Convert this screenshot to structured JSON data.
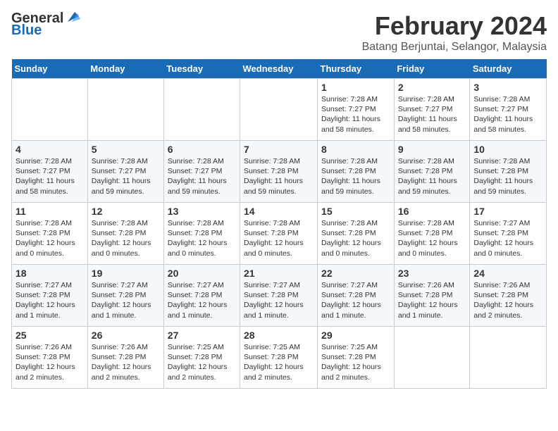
{
  "logo": {
    "line1": "General",
    "line2": "Blue"
  },
  "title": "February 2024",
  "subtitle": "Batang Berjuntai, Selangor, Malaysia",
  "weekdays": [
    "Sunday",
    "Monday",
    "Tuesday",
    "Wednesday",
    "Thursday",
    "Friday",
    "Saturday"
  ],
  "weeks": [
    [
      {
        "day": "",
        "info": ""
      },
      {
        "day": "",
        "info": ""
      },
      {
        "day": "",
        "info": ""
      },
      {
        "day": "",
        "info": ""
      },
      {
        "day": "1",
        "info": "Sunrise: 7:28 AM\nSunset: 7:27 PM\nDaylight: 11 hours\nand 58 minutes."
      },
      {
        "day": "2",
        "info": "Sunrise: 7:28 AM\nSunset: 7:27 PM\nDaylight: 11 hours\nand 58 minutes."
      },
      {
        "day": "3",
        "info": "Sunrise: 7:28 AM\nSunset: 7:27 PM\nDaylight: 11 hours\nand 58 minutes."
      }
    ],
    [
      {
        "day": "4",
        "info": "Sunrise: 7:28 AM\nSunset: 7:27 PM\nDaylight: 11 hours\nand 58 minutes."
      },
      {
        "day": "5",
        "info": "Sunrise: 7:28 AM\nSunset: 7:27 PM\nDaylight: 11 hours\nand 59 minutes."
      },
      {
        "day": "6",
        "info": "Sunrise: 7:28 AM\nSunset: 7:27 PM\nDaylight: 11 hours\nand 59 minutes."
      },
      {
        "day": "7",
        "info": "Sunrise: 7:28 AM\nSunset: 7:28 PM\nDaylight: 11 hours\nand 59 minutes."
      },
      {
        "day": "8",
        "info": "Sunrise: 7:28 AM\nSunset: 7:28 PM\nDaylight: 11 hours\nand 59 minutes."
      },
      {
        "day": "9",
        "info": "Sunrise: 7:28 AM\nSunset: 7:28 PM\nDaylight: 11 hours\nand 59 minutes."
      },
      {
        "day": "10",
        "info": "Sunrise: 7:28 AM\nSunset: 7:28 PM\nDaylight: 11 hours\nand 59 minutes."
      }
    ],
    [
      {
        "day": "11",
        "info": "Sunrise: 7:28 AM\nSunset: 7:28 PM\nDaylight: 12 hours\nand 0 minutes."
      },
      {
        "day": "12",
        "info": "Sunrise: 7:28 AM\nSunset: 7:28 PM\nDaylight: 12 hours\nand 0 minutes."
      },
      {
        "day": "13",
        "info": "Sunrise: 7:28 AM\nSunset: 7:28 PM\nDaylight: 12 hours\nand 0 minutes."
      },
      {
        "day": "14",
        "info": "Sunrise: 7:28 AM\nSunset: 7:28 PM\nDaylight: 12 hours\nand 0 minutes."
      },
      {
        "day": "15",
        "info": "Sunrise: 7:28 AM\nSunset: 7:28 PM\nDaylight: 12 hours\nand 0 minutes."
      },
      {
        "day": "16",
        "info": "Sunrise: 7:28 AM\nSunset: 7:28 PM\nDaylight: 12 hours\nand 0 minutes."
      },
      {
        "day": "17",
        "info": "Sunrise: 7:27 AM\nSunset: 7:28 PM\nDaylight: 12 hours\nand 0 minutes."
      }
    ],
    [
      {
        "day": "18",
        "info": "Sunrise: 7:27 AM\nSunset: 7:28 PM\nDaylight: 12 hours\nand 1 minute."
      },
      {
        "day": "19",
        "info": "Sunrise: 7:27 AM\nSunset: 7:28 PM\nDaylight: 12 hours\nand 1 minute."
      },
      {
        "day": "20",
        "info": "Sunrise: 7:27 AM\nSunset: 7:28 PM\nDaylight: 12 hours\nand 1 minute."
      },
      {
        "day": "21",
        "info": "Sunrise: 7:27 AM\nSunset: 7:28 PM\nDaylight: 12 hours\nand 1 minute."
      },
      {
        "day": "22",
        "info": "Sunrise: 7:27 AM\nSunset: 7:28 PM\nDaylight: 12 hours\nand 1 minute."
      },
      {
        "day": "23",
        "info": "Sunrise: 7:26 AM\nSunset: 7:28 PM\nDaylight: 12 hours\nand 1 minute."
      },
      {
        "day": "24",
        "info": "Sunrise: 7:26 AM\nSunset: 7:28 PM\nDaylight: 12 hours\nand 2 minutes."
      }
    ],
    [
      {
        "day": "25",
        "info": "Sunrise: 7:26 AM\nSunset: 7:28 PM\nDaylight: 12 hours\nand 2 minutes."
      },
      {
        "day": "26",
        "info": "Sunrise: 7:26 AM\nSunset: 7:28 PM\nDaylight: 12 hours\nand 2 minutes."
      },
      {
        "day": "27",
        "info": "Sunrise: 7:25 AM\nSunset: 7:28 PM\nDaylight: 12 hours\nand 2 minutes."
      },
      {
        "day": "28",
        "info": "Sunrise: 7:25 AM\nSunset: 7:28 PM\nDaylight: 12 hours\nand 2 minutes."
      },
      {
        "day": "29",
        "info": "Sunrise: 7:25 AM\nSunset: 7:28 PM\nDaylight: 12 hours\nand 2 minutes."
      },
      {
        "day": "",
        "info": ""
      },
      {
        "day": "",
        "info": ""
      }
    ]
  ]
}
